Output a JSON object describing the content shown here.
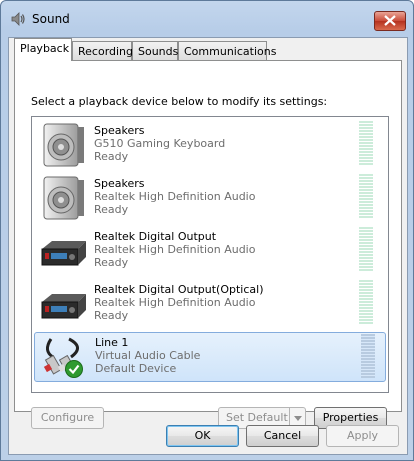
{
  "window": {
    "title": "Sound"
  },
  "tabs": [
    {
      "label": "Playback",
      "active": true
    },
    {
      "label": "Recording"
    },
    {
      "label": "Sounds"
    },
    {
      "label": "Communications"
    }
  ],
  "prompt": "Select a playback device below to modify its settings:",
  "devices": [
    {
      "name": "Speakers",
      "description": "G510 Gaming Keyboard",
      "status": "Ready",
      "icon": "speaker-icon"
    },
    {
      "name": "Speakers",
      "description": "Realtek High Definition Audio",
      "status": "Ready",
      "icon": "speaker-icon"
    },
    {
      "name": "Realtek Digital Output",
      "description": "Realtek High Definition Audio",
      "status": "Ready",
      "icon": "digital-output-icon"
    },
    {
      "name": "Realtek Digital Output(Optical)",
      "description": "Realtek High Definition Audio",
      "status": "Ready",
      "icon": "digital-output-icon"
    },
    {
      "name": "Line 1",
      "description": "Virtual Audio Cable",
      "status": "Default Device",
      "icon": "audio-cable-icon",
      "selected": true,
      "default_check": "green-check-icon"
    }
  ],
  "buttons": {
    "configure": "Configure",
    "set_default": "Set Default",
    "properties": "Properties",
    "ok": "OK",
    "cancel": "Cancel",
    "apply": "Apply"
  }
}
